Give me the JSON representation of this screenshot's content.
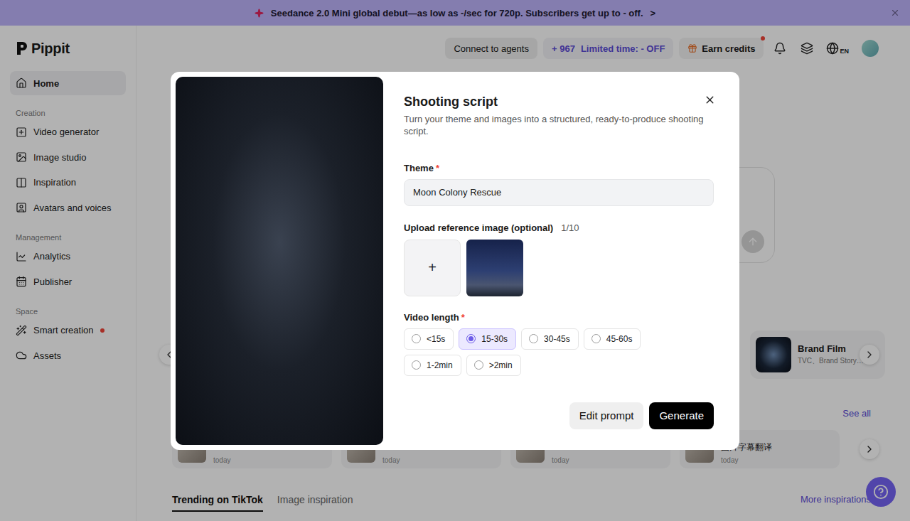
{
  "banner": {
    "text": "Seedance 2.0 Mini global debut—as low as -/sec for 720p. Subscribers get up to - off.",
    "arrow": ">"
  },
  "header": {
    "logo": "Pippit",
    "connect": "Connect to agents",
    "credits": {
      "plus": "+",
      "amount": "967",
      "promo": "Limited time: - OFF"
    },
    "earn": {
      "label": "Earn credits",
      "dot": true
    },
    "language": "EN"
  },
  "sidebar": [
    {
      "items": [
        {
          "label": "Home",
          "selected": true,
          "dot": false
        }
      ]
    },
    {
      "title": "Creation",
      "items": [
        {
          "label": "Video generator",
          "selected": false,
          "dot": false
        },
        {
          "label": "Image studio",
          "selected": false,
          "dot": false
        },
        {
          "label": "Inspiration",
          "selected": false,
          "dot": false
        },
        {
          "label": "Avatars and voices",
          "selected": false,
          "dot": false
        }
      ]
    },
    {
      "title": "Management",
      "items": [
        {
          "label": "Analytics",
          "selected": false,
          "dot": false
        },
        {
          "label": "Publisher",
          "selected": false,
          "dot": false
        }
      ]
    },
    {
      "title": "Space",
      "items": [
        {
          "label": "Smart creation",
          "selected": false,
          "dot": true
        },
        {
          "label": "Assets",
          "selected": false,
          "dot": false
        }
      ]
    }
  ],
  "carousel": {
    "cards": [
      {
        "title": "Brand Film",
        "subtitle": "TVC、Brand Story…"
      }
    ]
  },
  "recent": {
    "see_all": "See all",
    "items": [
      {
        "time": "today"
      },
      {
        "time": "today"
      },
      {
        "time": "today"
      },
      {
        "title": "图片字幕翻译",
        "time": "today"
      }
    ]
  },
  "tabs": [
    {
      "label": "Trending on TikTok",
      "selected": true
    },
    {
      "label": "Image inspiration",
      "selected": false
    }
  ],
  "more": "More inspirations",
  "modal": {
    "title": "Shooting script",
    "subtitle": "Turn your theme and images into a structured, ready-to-produce shooting script.",
    "theme": {
      "label": "Theme",
      "mark": "*",
      "value": "Moon Colony Rescue"
    },
    "upload": {
      "label": "Upload reference image (optional)",
      "count": "1/10",
      "plus": "+"
    },
    "length": {
      "label": "Video length",
      "mark": "*",
      "options": [
        {
          "label": "<15s",
          "selected": false
        },
        {
          "label": "15-30s",
          "selected": true
        },
        {
          "label": "30-45s",
          "selected": false
        },
        {
          "label": "45-60s",
          "selected": false
        },
        {
          "label": "1-2min",
          "selected": false
        },
        {
          "label": ">2min",
          "selected": false
        }
      ]
    },
    "buttons": {
      "edit": "Edit prompt",
      "generate": "Generate"
    }
  }
}
